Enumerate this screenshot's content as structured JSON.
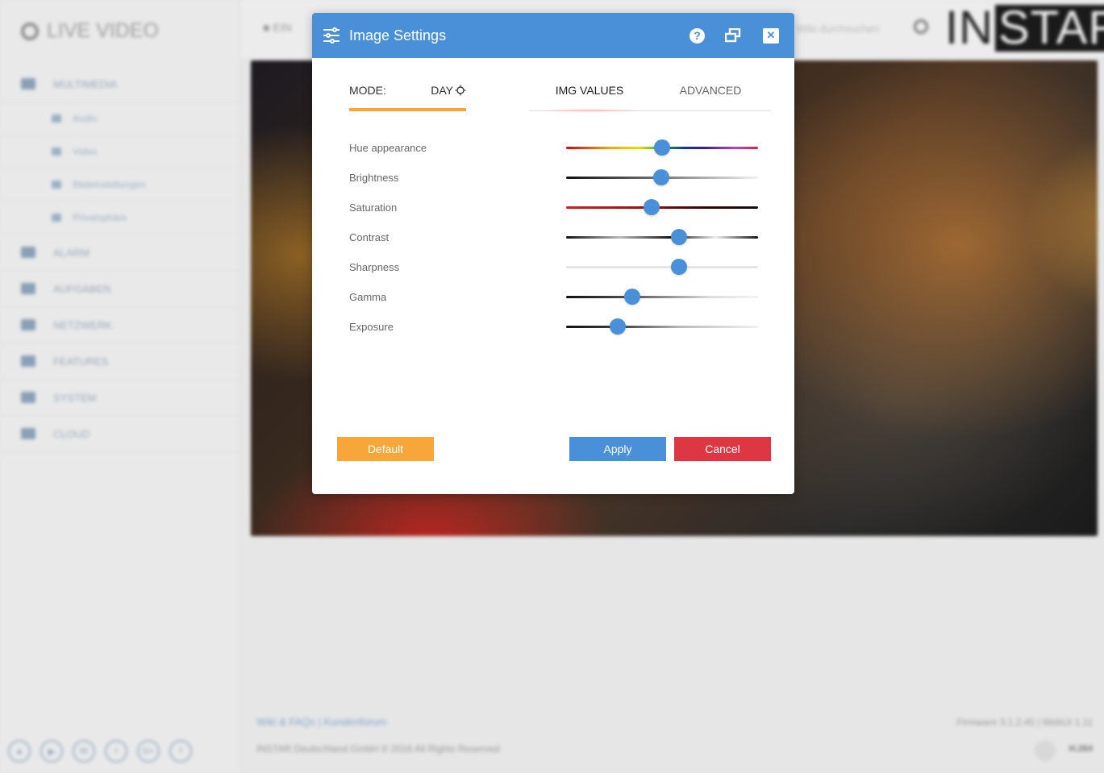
{
  "background": {
    "app_title": "LIVE VIDEO",
    "sidebar": {
      "items": [
        {
          "label": "MULTIMEDIA",
          "icon": "image-icon"
        },
        {
          "label": "Audio",
          "icon": "speaker-icon",
          "sub": true
        },
        {
          "label": "Video",
          "icon": "film-icon",
          "sub": true
        },
        {
          "label": "Bildeinstellungen",
          "icon": "sliders-icon",
          "sub": true
        },
        {
          "label": "Privatsphäre",
          "icon": "privacy-icon",
          "sub": true
        },
        {
          "label": "ALARM",
          "icon": "bell-icon"
        },
        {
          "label": "AUFGABEN",
          "icon": "tasks-icon"
        },
        {
          "label": "NETZWERK",
          "icon": "network-icon"
        },
        {
          "label": "FEATURES",
          "icon": "features-icon"
        },
        {
          "label": "SYSTEM",
          "icon": "gear-icon"
        },
        {
          "label": "CLOUD",
          "icon": "cloud-icon"
        }
      ],
      "social": [
        {
          "label": "▲",
          "icon": "instar-icon"
        },
        {
          "label": "▶",
          "icon": "youtube-icon"
        },
        {
          "label": "W",
          "icon": "wiki-icon"
        },
        {
          "label": "t",
          "icon": "twitter-icon"
        },
        {
          "label": "G+",
          "icon": "googleplus-icon"
        },
        {
          "label": "f",
          "icon": "facebook-icon"
        }
      ]
    },
    "topbar": {
      "camera_label": "EIN",
      "search_placeholder": "Wiki durchsuchen",
      "logo_in": "IN",
      "logo_star": "STAR"
    },
    "footer": {
      "links": "Wiki & FAQs | Kundenforum",
      "copyright": "INSTAR Deutschland GmbH © 2016 All Rights Reserved",
      "firmware": "Firmware 3.1.2.45 | WebUI 1.11",
      "codec": "H.264"
    }
  },
  "modal": {
    "title": "Image Settings",
    "header_icons": {
      "settings": "sliders-icon",
      "help": "help-icon",
      "window": "window-restore-icon",
      "close": "close-icon"
    },
    "mode_label": "MODE:",
    "mode_value": "DAY",
    "mode_icon": "sun-icon",
    "tabs": [
      {
        "label": "IMG VALUES",
        "active": true
      },
      {
        "label": "ADVANCED",
        "active": false
      }
    ],
    "sliders": [
      {
        "label": "Hue appearance",
        "value": 0.5
      },
      {
        "label": "Brightness",
        "value": 0.495
      },
      {
        "label": "Saturation",
        "value": 0.445
      },
      {
        "label": "Contrast",
        "value": 0.588
      },
      {
        "label": "Sharpness",
        "value": 0.588
      },
      {
        "label": "Gamma",
        "value": 0.345
      },
      {
        "label": "Exposure",
        "value": 0.27
      }
    ],
    "buttons": {
      "default": "Default",
      "apply": "Apply",
      "cancel": "Cancel"
    }
  },
  "colors": {
    "accent_blue": "#4a90d9",
    "accent_orange": "#f7a63a",
    "cancel_red": "#dd3744"
  }
}
